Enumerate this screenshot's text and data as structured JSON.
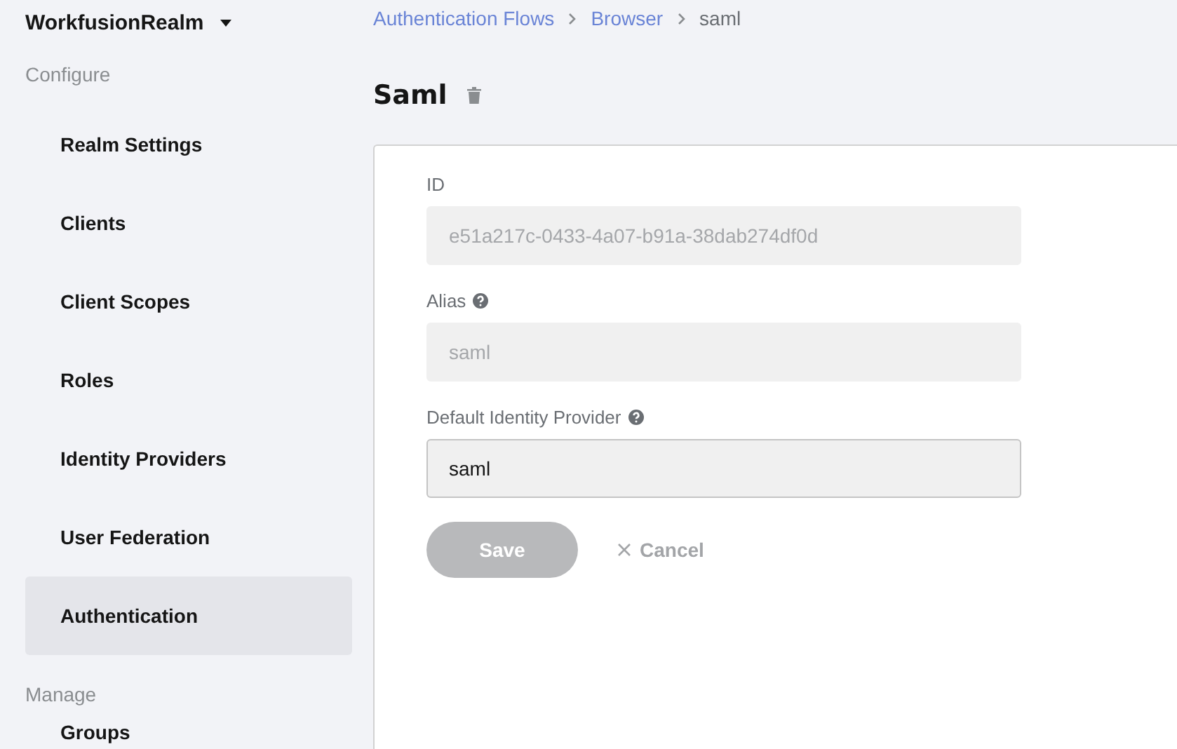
{
  "realm_selector": {
    "label": "WorkfusionRealm"
  },
  "sidebar": {
    "sections": [
      {
        "title": "Configure",
        "items": [
          {
            "label": "Realm Settings",
            "selected": false
          },
          {
            "label": "Clients",
            "selected": false
          },
          {
            "label": "Client Scopes",
            "selected": false
          },
          {
            "label": "Roles",
            "selected": false
          },
          {
            "label": "Identity Providers",
            "selected": false
          },
          {
            "label": "User Federation",
            "selected": false
          },
          {
            "label": "Authentication",
            "selected": true
          }
        ]
      },
      {
        "title": "Manage",
        "items": [
          {
            "label": "Groups",
            "selected": false
          }
        ]
      }
    ]
  },
  "breadcrumb": [
    {
      "label": "Authentication Flows",
      "link": true
    },
    {
      "label": "Browser",
      "link": true
    },
    {
      "label": "saml",
      "link": false
    }
  ],
  "page_title": "Saml",
  "form": {
    "fields": [
      {
        "label": "ID",
        "help": false,
        "value": "e51a217c-0433-4a07-b91a-38dab274df0d",
        "disabled": true
      },
      {
        "label": "Alias",
        "help": true,
        "value": "saml",
        "disabled": true
      },
      {
        "label": "Default Identity Provider",
        "help": true,
        "value": "saml",
        "disabled": false
      }
    ],
    "save_button": {
      "label": "Save",
      "disabled": true
    },
    "cancel_button": {
      "label": "Cancel"
    }
  }
}
